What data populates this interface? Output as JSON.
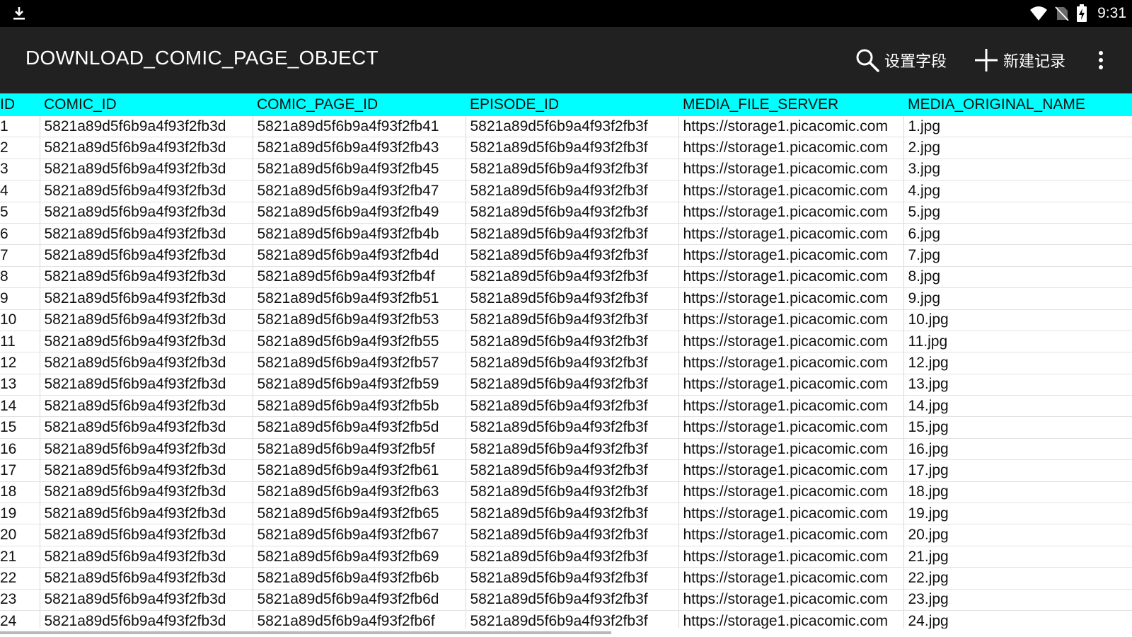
{
  "status_bar": {
    "time": "9:31",
    "icons": [
      "download-icon",
      "wifi-icon",
      "no-sim-icon",
      "battery-charging-icon"
    ]
  },
  "app_bar": {
    "title": "DOWNLOAD_COMIC_PAGE_OBJECT",
    "actions": [
      {
        "icon": "search-icon",
        "label": "设置字段"
      },
      {
        "icon": "plus-icon",
        "label": "新建记录"
      },
      {
        "icon": "overflow-menu-icon",
        "label": ""
      }
    ]
  },
  "colors": {
    "status_bar": "#000000",
    "app_bar": "#212121",
    "header_row": "#00ffff"
  },
  "table": {
    "columns": [
      "ID",
      "COMIC_ID",
      "COMIC_PAGE_ID",
      "EPISODE_ID",
      "MEDIA_FILE_SERVER",
      "MEDIA_ORIGINAL_NAME"
    ],
    "rows": [
      [
        "1",
        "5821a89d5f6b9a4f93f2fb3d",
        "5821a89d5f6b9a4f93f2fb41",
        "5821a89d5f6b9a4f93f2fb3f",
        "https://storage1.picacomic.com",
        "1.jpg"
      ],
      [
        "2",
        "5821a89d5f6b9a4f93f2fb3d",
        "5821a89d5f6b9a4f93f2fb43",
        "5821a89d5f6b9a4f93f2fb3f",
        "https://storage1.picacomic.com",
        "2.jpg"
      ],
      [
        "3",
        "5821a89d5f6b9a4f93f2fb3d",
        "5821a89d5f6b9a4f93f2fb45",
        "5821a89d5f6b9a4f93f2fb3f",
        "https://storage1.picacomic.com",
        "3.jpg"
      ],
      [
        "4",
        "5821a89d5f6b9a4f93f2fb3d",
        "5821a89d5f6b9a4f93f2fb47",
        "5821a89d5f6b9a4f93f2fb3f",
        "https://storage1.picacomic.com",
        "4.jpg"
      ],
      [
        "5",
        "5821a89d5f6b9a4f93f2fb3d",
        "5821a89d5f6b9a4f93f2fb49",
        "5821a89d5f6b9a4f93f2fb3f",
        "https://storage1.picacomic.com",
        "5.jpg"
      ],
      [
        "6",
        "5821a89d5f6b9a4f93f2fb3d",
        "5821a89d5f6b9a4f93f2fb4b",
        "5821a89d5f6b9a4f93f2fb3f",
        "https://storage1.picacomic.com",
        "6.jpg"
      ],
      [
        "7",
        "5821a89d5f6b9a4f93f2fb3d",
        "5821a89d5f6b9a4f93f2fb4d",
        "5821a89d5f6b9a4f93f2fb3f",
        "https://storage1.picacomic.com",
        "7.jpg"
      ],
      [
        "8",
        "5821a89d5f6b9a4f93f2fb3d",
        "5821a89d5f6b9a4f93f2fb4f",
        "5821a89d5f6b9a4f93f2fb3f",
        "https://storage1.picacomic.com",
        "8.jpg"
      ],
      [
        "9",
        "5821a89d5f6b9a4f93f2fb3d",
        "5821a89d5f6b9a4f93f2fb51",
        "5821a89d5f6b9a4f93f2fb3f",
        "https://storage1.picacomic.com",
        "9.jpg"
      ],
      [
        "10",
        "5821a89d5f6b9a4f93f2fb3d",
        "5821a89d5f6b9a4f93f2fb53",
        "5821a89d5f6b9a4f93f2fb3f",
        "https://storage1.picacomic.com",
        "10.jpg"
      ],
      [
        "11",
        "5821a89d5f6b9a4f93f2fb3d",
        "5821a89d5f6b9a4f93f2fb55",
        "5821a89d5f6b9a4f93f2fb3f",
        "https://storage1.picacomic.com",
        "11.jpg"
      ],
      [
        "12",
        "5821a89d5f6b9a4f93f2fb3d",
        "5821a89d5f6b9a4f93f2fb57",
        "5821a89d5f6b9a4f93f2fb3f",
        "https://storage1.picacomic.com",
        "12.jpg"
      ],
      [
        "13",
        "5821a89d5f6b9a4f93f2fb3d",
        "5821a89d5f6b9a4f93f2fb59",
        "5821a89d5f6b9a4f93f2fb3f",
        "https://storage1.picacomic.com",
        "13.jpg"
      ],
      [
        "14",
        "5821a89d5f6b9a4f93f2fb3d",
        "5821a89d5f6b9a4f93f2fb5b",
        "5821a89d5f6b9a4f93f2fb3f",
        "https://storage1.picacomic.com",
        "14.jpg"
      ],
      [
        "15",
        "5821a89d5f6b9a4f93f2fb3d",
        "5821a89d5f6b9a4f93f2fb5d",
        "5821a89d5f6b9a4f93f2fb3f",
        "https://storage1.picacomic.com",
        "15.jpg"
      ],
      [
        "16",
        "5821a89d5f6b9a4f93f2fb3d",
        "5821a89d5f6b9a4f93f2fb5f",
        "5821a89d5f6b9a4f93f2fb3f",
        "https://storage1.picacomic.com",
        "16.jpg"
      ],
      [
        "17",
        "5821a89d5f6b9a4f93f2fb3d",
        "5821a89d5f6b9a4f93f2fb61",
        "5821a89d5f6b9a4f93f2fb3f",
        "https://storage1.picacomic.com",
        "17.jpg"
      ],
      [
        "18",
        "5821a89d5f6b9a4f93f2fb3d",
        "5821a89d5f6b9a4f93f2fb63",
        "5821a89d5f6b9a4f93f2fb3f",
        "https://storage1.picacomic.com",
        "18.jpg"
      ],
      [
        "19",
        "5821a89d5f6b9a4f93f2fb3d",
        "5821a89d5f6b9a4f93f2fb65",
        "5821a89d5f6b9a4f93f2fb3f",
        "https://storage1.picacomic.com",
        "19.jpg"
      ],
      [
        "20",
        "5821a89d5f6b9a4f93f2fb3d",
        "5821a89d5f6b9a4f93f2fb67",
        "5821a89d5f6b9a4f93f2fb3f",
        "https://storage1.picacomic.com",
        "20.jpg"
      ],
      [
        "21",
        "5821a89d5f6b9a4f93f2fb3d",
        "5821a89d5f6b9a4f93f2fb69",
        "5821a89d5f6b9a4f93f2fb3f",
        "https://storage1.picacomic.com",
        "21.jpg"
      ],
      [
        "22",
        "5821a89d5f6b9a4f93f2fb3d",
        "5821a89d5f6b9a4f93f2fb6b",
        "5821a89d5f6b9a4f93f2fb3f",
        "https://storage1.picacomic.com",
        "22.jpg"
      ],
      [
        "23",
        "5821a89d5f6b9a4f93f2fb3d",
        "5821a89d5f6b9a4f93f2fb6d",
        "5821a89d5f6b9a4f93f2fb3f",
        "https://storage1.picacomic.com",
        "23.jpg"
      ],
      [
        "24",
        "5821a89d5f6b9a4f93f2fb3d",
        "5821a89d5f6b9a4f93f2fb6f",
        "5821a89d5f6b9a4f93f2fb3f",
        "https://storage1.picacomic.com",
        "24.jpg"
      ]
    ]
  },
  "scrollbar": {
    "horizontal_visible_fraction": 0.54
  }
}
